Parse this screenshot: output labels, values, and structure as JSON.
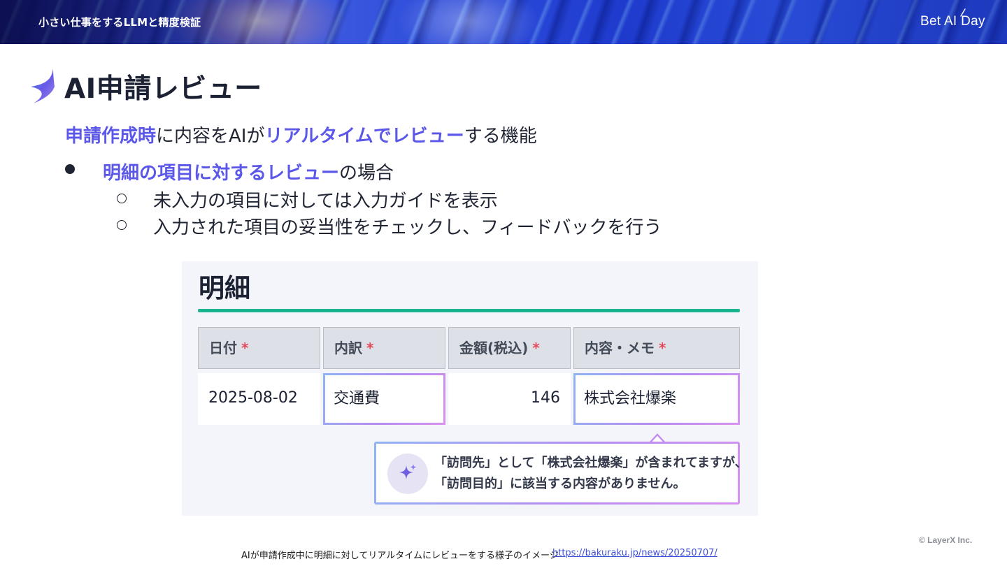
{
  "header": {
    "deck_title": "小さい仕事をするLLMと精度検証",
    "logo": "Bet AI Day"
  },
  "slide": {
    "title": "AI申請レビュー",
    "lead": {
      "em1": "申請作成時",
      "t1": "に内容をAIが",
      "em2": "リアルタイムでレビュー",
      "t2": "する機能"
    },
    "bullet": {
      "em": "明細の項目に対するレビュー",
      "text": "の場合"
    },
    "sub_items": [
      "未入力の項目に対しては入力ガイドを表示",
      "入力された項目の妥当性をチェックし、フィードバックを行う"
    ]
  },
  "screenshot": {
    "heading": "明細",
    "required_mark": "*",
    "columns": [
      "日付",
      "内訳",
      "金額(税込)",
      "内容・メモ"
    ],
    "row": [
      "2025-08-02",
      "交通費",
      "146",
      "株式会社爆楽"
    ],
    "feedback_lines": [
      "「訪問先」として「株式会社爆楽」が含まれてますが、",
      "「訪問目的」に該当する内容がありません。"
    ],
    "colors": {
      "accent_rule": "#19b58e",
      "ai_border": "#b68cf0",
      "required": "#e2465a"
    }
  },
  "footer": {
    "caption": "AIが申請作成中に明細に対してリアルタイムにレビューをする様子のイメージ",
    "link": "https://bakuraku.jp/news/20250707/",
    "copyright": "© LayerX Inc."
  },
  "theme": {
    "emphasis": "#5b57e8",
    "text": "#1f2433"
  }
}
